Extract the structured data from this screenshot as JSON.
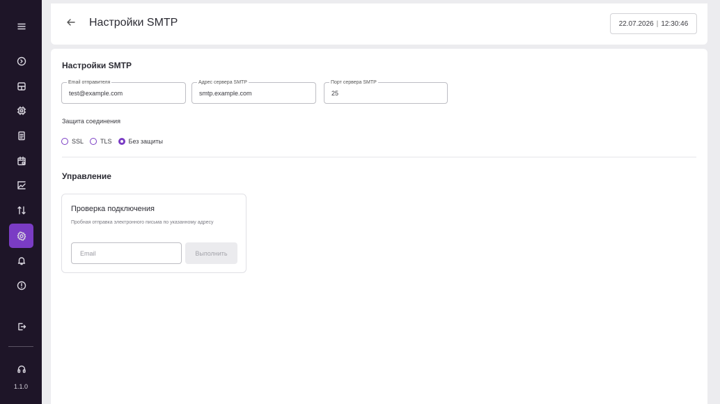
{
  "sidebar": {
    "items": [
      {
        "icon": "menu-icon"
      },
      {
        "icon": "chevron-circle-icon"
      },
      {
        "icon": "dashboard-icon"
      },
      {
        "icon": "chip-icon"
      },
      {
        "icon": "document-icon"
      },
      {
        "icon": "calendar-icon"
      },
      {
        "icon": "chart-icon"
      },
      {
        "icon": "transfer-icon"
      },
      {
        "icon": "gear-icon",
        "active": true
      },
      {
        "icon": "bell-icon"
      },
      {
        "icon": "alert-icon"
      },
      {
        "icon": "logout-icon"
      },
      {
        "icon": "headset-icon"
      }
    ],
    "version": "1.1.0"
  },
  "header": {
    "title": "Настройки SMTP",
    "date": "22.07.2026",
    "separator": "|",
    "time": "12:30:46"
  },
  "smtp": {
    "section_title": "Настройки SMTP",
    "sender_email_label": "Email отправителя",
    "sender_email_value": "test@example.com",
    "server_address_label": "Адрес сервера SMTP",
    "server_address_value": "smtp.example.com",
    "server_port_label": "Порт сервера SMTP",
    "server_port_value": "25",
    "protection_label": "Защита соединения",
    "protection_options": [
      "SSL",
      "TLS",
      "Без защиты"
    ],
    "protection_selected": "Без защиты"
  },
  "management": {
    "section_title": "Управление",
    "card_title": "Проверка подключения",
    "card_description": "Пробная отправка электронного письма по указанному адресу",
    "email_placeholder": "Email",
    "run_button": "Выполнить"
  },
  "colors": {
    "accent": "#7a3cc4",
    "sidebar": "#1e1528",
    "background": "#ececef"
  }
}
